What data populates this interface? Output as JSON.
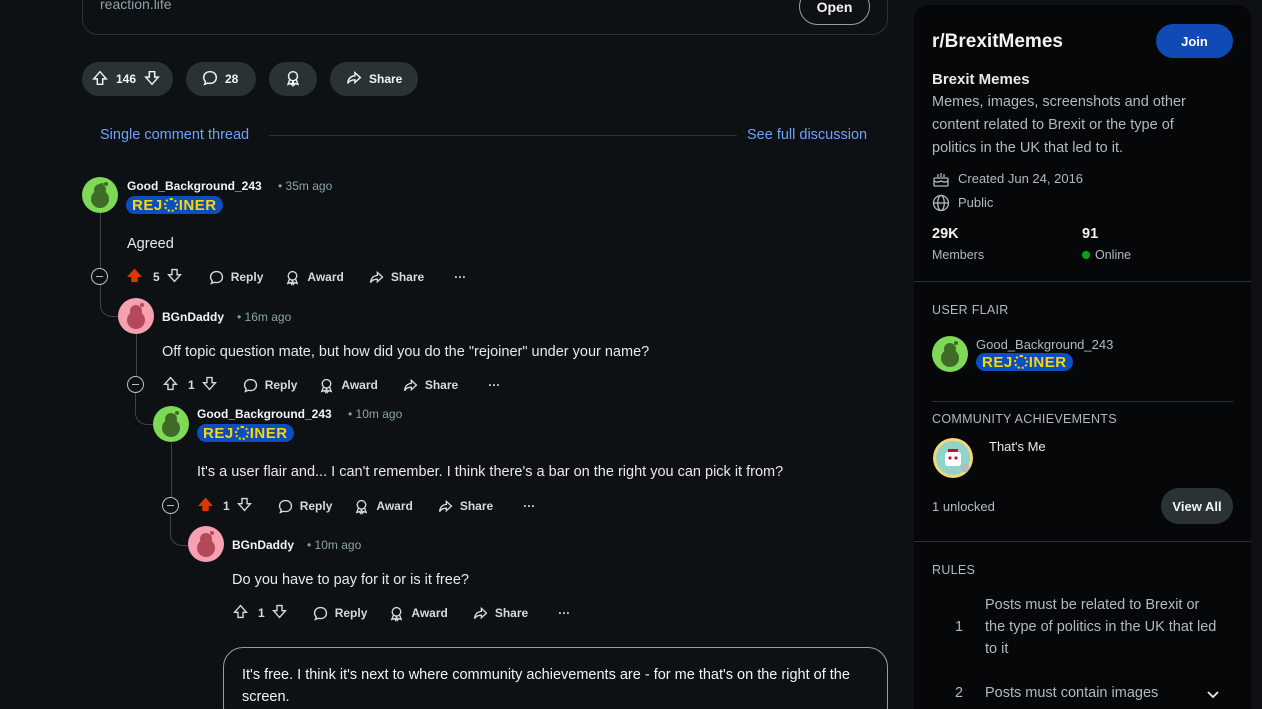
{
  "post": {
    "link_domain": "reaction.life",
    "open_label": "Open",
    "votes": "146",
    "comments": "28",
    "share_label": "Share"
  },
  "thread": {
    "single_label": "Single comment thread",
    "full_label": "See full discussion"
  },
  "comments": [
    {
      "user": "Good_Background_243",
      "time": "35m ago",
      "flair": "REJOINER",
      "text": "Agreed",
      "votes": "5",
      "upvoted": true
    },
    {
      "user": "BGnDaddy",
      "time": "16m ago",
      "flair": "",
      "text": "Off topic question mate, but how did you do the \"rejoiner\" under your name?",
      "votes": "1",
      "upvoted": false
    },
    {
      "user": "Good_Background_243",
      "time": "10m ago",
      "flair": "REJOINER",
      "text": "It's a user flair and... I can't remember. I think there's a bar on the right you can pick it from?",
      "votes": "1",
      "upvoted": true
    },
    {
      "user": "BGnDaddy",
      "time": "10m ago",
      "flair": "",
      "text": "Do you have to pay for it or is it free?",
      "votes": "1",
      "upvoted": false
    }
  ],
  "actions": {
    "reply": "Reply",
    "award": "Award",
    "share": "Share",
    "more": "···",
    "dot": "•"
  },
  "reply_draft": "It's free. I think it's next to where community achievements are - for me that's on the right of the screen.",
  "sidebar": {
    "name": "r/BrexitMemes",
    "join_label": "Join",
    "title": "Brexit Memes",
    "description": "Memes, images, screenshots and other content related to Brexit or the type of politics in the UK that led to it.",
    "created": "Created Jun 24, 2016",
    "visibility": "Public",
    "members_count": "29K",
    "members_label": "Members",
    "online_count": "91",
    "online_label": "Online",
    "user_flair_heading": "USER FLAIR",
    "flair_user": "Good_Background_243",
    "achievements_heading": "COMMUNITY ACHIEVEMENTS",
    "achievement_name": "That's Me",
    "unlocked": "1 unlocked",
    "view_all": "View All",
    "rules_heading": "RULES",
    "rules": [
      {
        "num": "1",
        "text": "Posts must be related to Brexit or the type of politics in the UK that led to it"
      },
      {
        "num": "2",
        "text": "Posts must contain images"
      }
    ]
  },
  "colors": {
    "accent": "#0f4ab5",
    "upvote": "#d93900",
    "online": "#01a816",
    "link": "#6fa0ff"
  }
}
